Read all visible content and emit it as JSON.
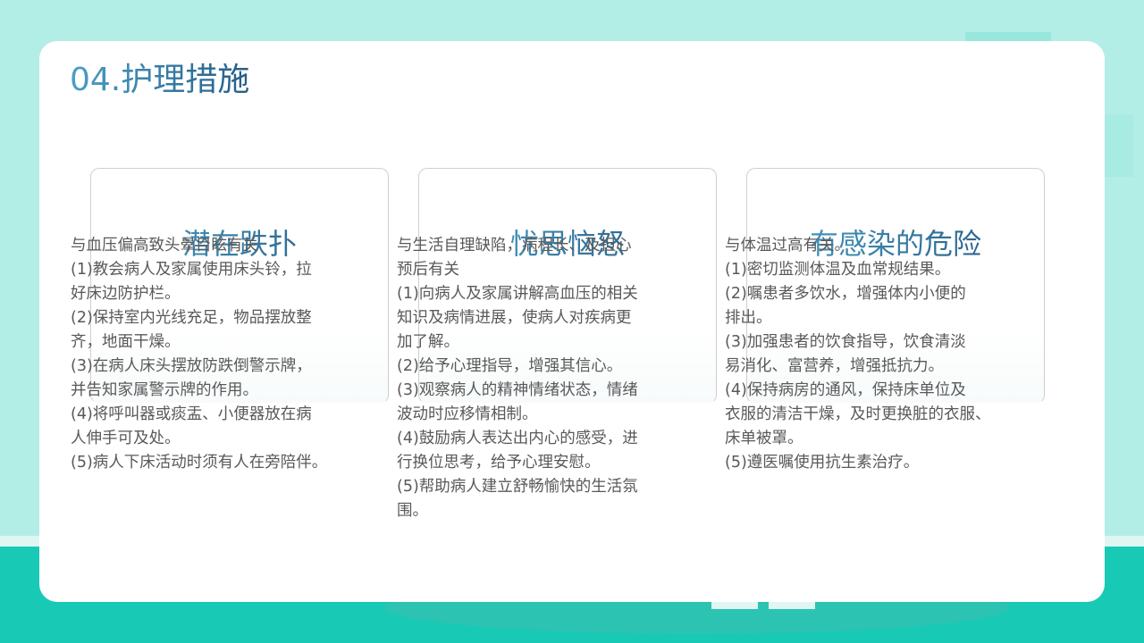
{
  "title": "04.护理措施",
  "sections": [
    {
      "heading": "潜在跌扑",
      "lines": [
        "与血压偏高致头晕目眩有关",
        "(1)教会病人及家属使用床头铃，拉",
        "好床边防护栏。",
        "(2)保持室内光线充足，物品摆放整",
        "齐，地面干燥。",
        "(3)在病人床头摆放防跌倒警示牌，",
        "并告知家属警示牌的作用。",
        "(4)将呼叫器或痰盂、小便器放在病",
        "人伸手可及处。",
        "(5)病人下床活动时须有人在旁陪伴。"
      ]
    },
    {
      "heading": "忧思恼怒",
      "lines": [
        "与生活自理缺陷，病程长、及担心",
        "预后有关",
        "(1)向病人及家属讲解高血压的相关",
        "知识及病情进展，使病人对疾病更",
        "加了解。",
        "(2)给予心理指导，增强其信心。",
        "(3)观察病人的精神情绪状态，情绪",
        "波动时应移情相制。",
        "(4)鼓励病人表达出内心的感受，进",
        "行换位思考，给予心理安慰。",
        "(5)帮助病人建立舒畅愉快的生活氛",
        "围。"
      ]
    },
    {
      "heading": "有感染的危险",
      "lines": [
        "与体温过高有关。",
        "(1)密切监测体温及血常规结果。",
        "(2)嘱患者多饮水，增强体内小便的",
        "排出。",
        "(3)加强患者的饮食指导，饮食清淡",
        "易消化、富营养，增强抵抗力。",
        " (4)保持病房的通风，保持床单位及",
        "衣服的清洁干燥，及时更换脏的衣服、",
        "床单被罩。",
        " (5)遵医嘱使用抗生素治疗。"
      ]
    }
  ]
}
